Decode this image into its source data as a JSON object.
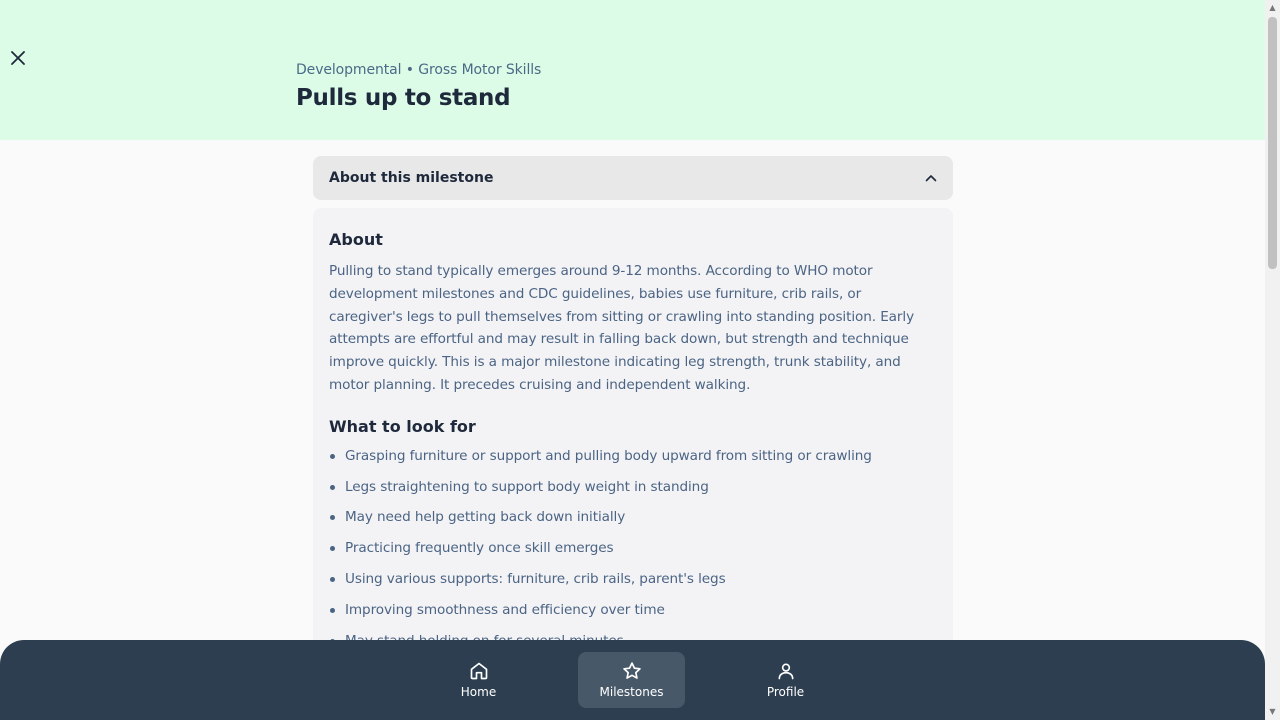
{
  "header": {
    "breadcrumb": "Developmental • Gross Motor Skills",
    "title": "Pulls up to stand"
  },
  "accordion": {
    "title": "About this milestone",
    "expanded": true
  },
  "about": {
    "heading": "About",
    "text": "Pulling to stand typically emerges around 9-12 months. According to WHO motor development milestones and CDC guidelines, babies use furniture, crib rails, or caregiver's legs to pull themselves from sitting or crawling into standing position. Early attempts are effortful and may result in falling back down, but strength and technique improve quickly. This is a major milestone indicating leg strength, trunk stability, and motor planning. It precedes cruising and independent walking."
  },
  "look_for": {
    "heading": "What to look for",
    "items": [
      "Grasping furniture or support and pulling body upward from sitting or crawling",
      "Legs straightening to support body weight in standing",
      "May need help getting back down initially",
      "Practicing frequently once skill emerges",
      "Using various supports: furniture, crib rails, parent's legs",
      "Improving smoothness and efficiency over time",
      "May stand holding on for several minutes"
    ]
  },
  "nav": {
    "items": [
      {
        "label": "Home",
        "icon": "home-icon"
      },
      {
        "label": "Milestones",
        "icon": "star-icon",
        "active": true
      },
      {
        "label": "Profile",
        "icon": "user-icon"
      }
    ]
  },
  "colors": {
    "header_bg": "#dcfce7",
    "nav_bg": "#2c3e50",
    "nav_active": "#475869"
  }
}
